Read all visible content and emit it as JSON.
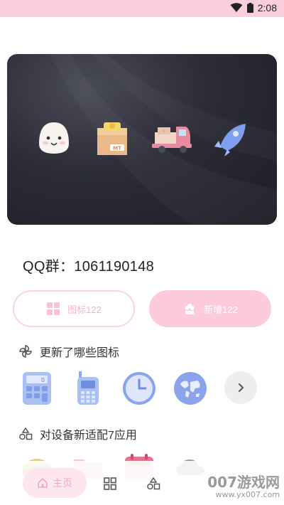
{
  "status_bar": {
    "time": "2:08",
    "wifi_icon": "wifi-icon",
    "battery_icon": "battery-icon"
  },
  "banner": {
    "icons": [
      "rice-ball-icon",
      "delivery-box-icon",
      "delivery-truck-icon",
      "rocket-icon"
    ]
  },
  "qq_group": "QQ群：1061190148",
  "buttons": {
    "icons": {
      "label": "图标122",
      "icon": "grid-icon"
    },
    "new": {
      "label": "新增122",
      "icon": "flower-icon"
    }
  },
  "section_updated": {
    "title": "更新了哪些图标",
    "icon": "pinwheel-icon",
    "apps": [
      "calculator-icon",
      "phone-icon",
      "clock-icon",
      "world-map-icon"
    ],
    "more_icon": "chevron-right-icon"
  },
  "section_adapted": {
    "title": "对设备新适配7应用",
    "icon": "shapes-icon",
    "apps": [
      "food-app-icon",
      "folder-app-icon",
      "calendar-app-icon",
      "cloud-app-icon"
    ]
  },
  "bottom_nav": {
    "home_label": "主页",
    "home_icon": "home-icon",
    "grid_icon": "grid-icon",
    "shapes_icon": "shapes-icon"
  },
  "watermark": {
    "big": "007游戏网",
    "small": "www.yx007.com"
  },
  "colors": {
    "status_bar": "#f9cfdc",
    "accent_pink": "#fbcbd9",
    "banner_dark": "#2b2c36"
  }
}
